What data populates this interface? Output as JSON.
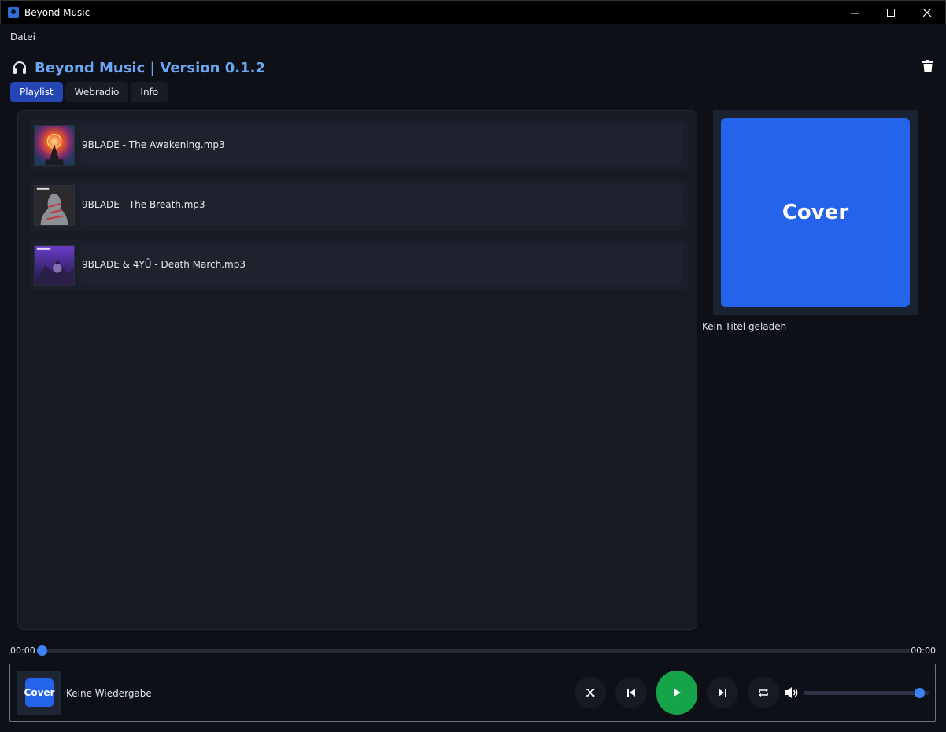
{
  "window": {
    "title": "Beyond Music",
    "minimize_icon": "minimize-icon",
    "maximize_icon": "maximize-icon",
    "close_icon": "close-icon"
  },
  "menu": {
    "items": [
      "Datei"
    ]
  },
  "header": {
    "title": "Beyond Music | Version 0.1.2",
    "icon": "headphones-icon",
    "action_icon": "trash-icon"
  },
  "tabs": [
    {
      "label": "Playlist",
      "active": true
    },
    {
      "label": "Webradio",
      "active": false
    },
    {
      "label": "Info",
      "active": false
    }
  ],
  "playlist": {
    "tracks": [
      {
        "name": "9BLADE - The Awakening.mp3"
      },
      {
        "name": "9BLADE - The Breath.mp3"
      },
      {
        "name": "9BLADE & 4YÛ - Death March.mp3"
      }
    ]
  },
  "now_playing": {
    "cover_text": "Cover",
    "title": "Kein Titel geladen"
  },
  "progress": {
    "current": "00:00",
    "total": "00:00",
    "fraction": 0.0
  },
  "player": {
    "mini_cover_text": "Cover",
    "status": "Keine Wiedergabe",
    "controls": [
      "shuffle-icon",
      "previous-icon",
      "play-icon",
      "next-icon",
      "repeat-icon"
    ],
    "volume_icon": "volume-icon",
    "volume": 0.92
  },
  "colors": {
    "accent": "#3b82f6",
    "active_tab": "#2547b6",
    "play_button": "#16a34a",
    "cover": "#2563eb",
    "title_text": "#6aa6f2"
  }
}
